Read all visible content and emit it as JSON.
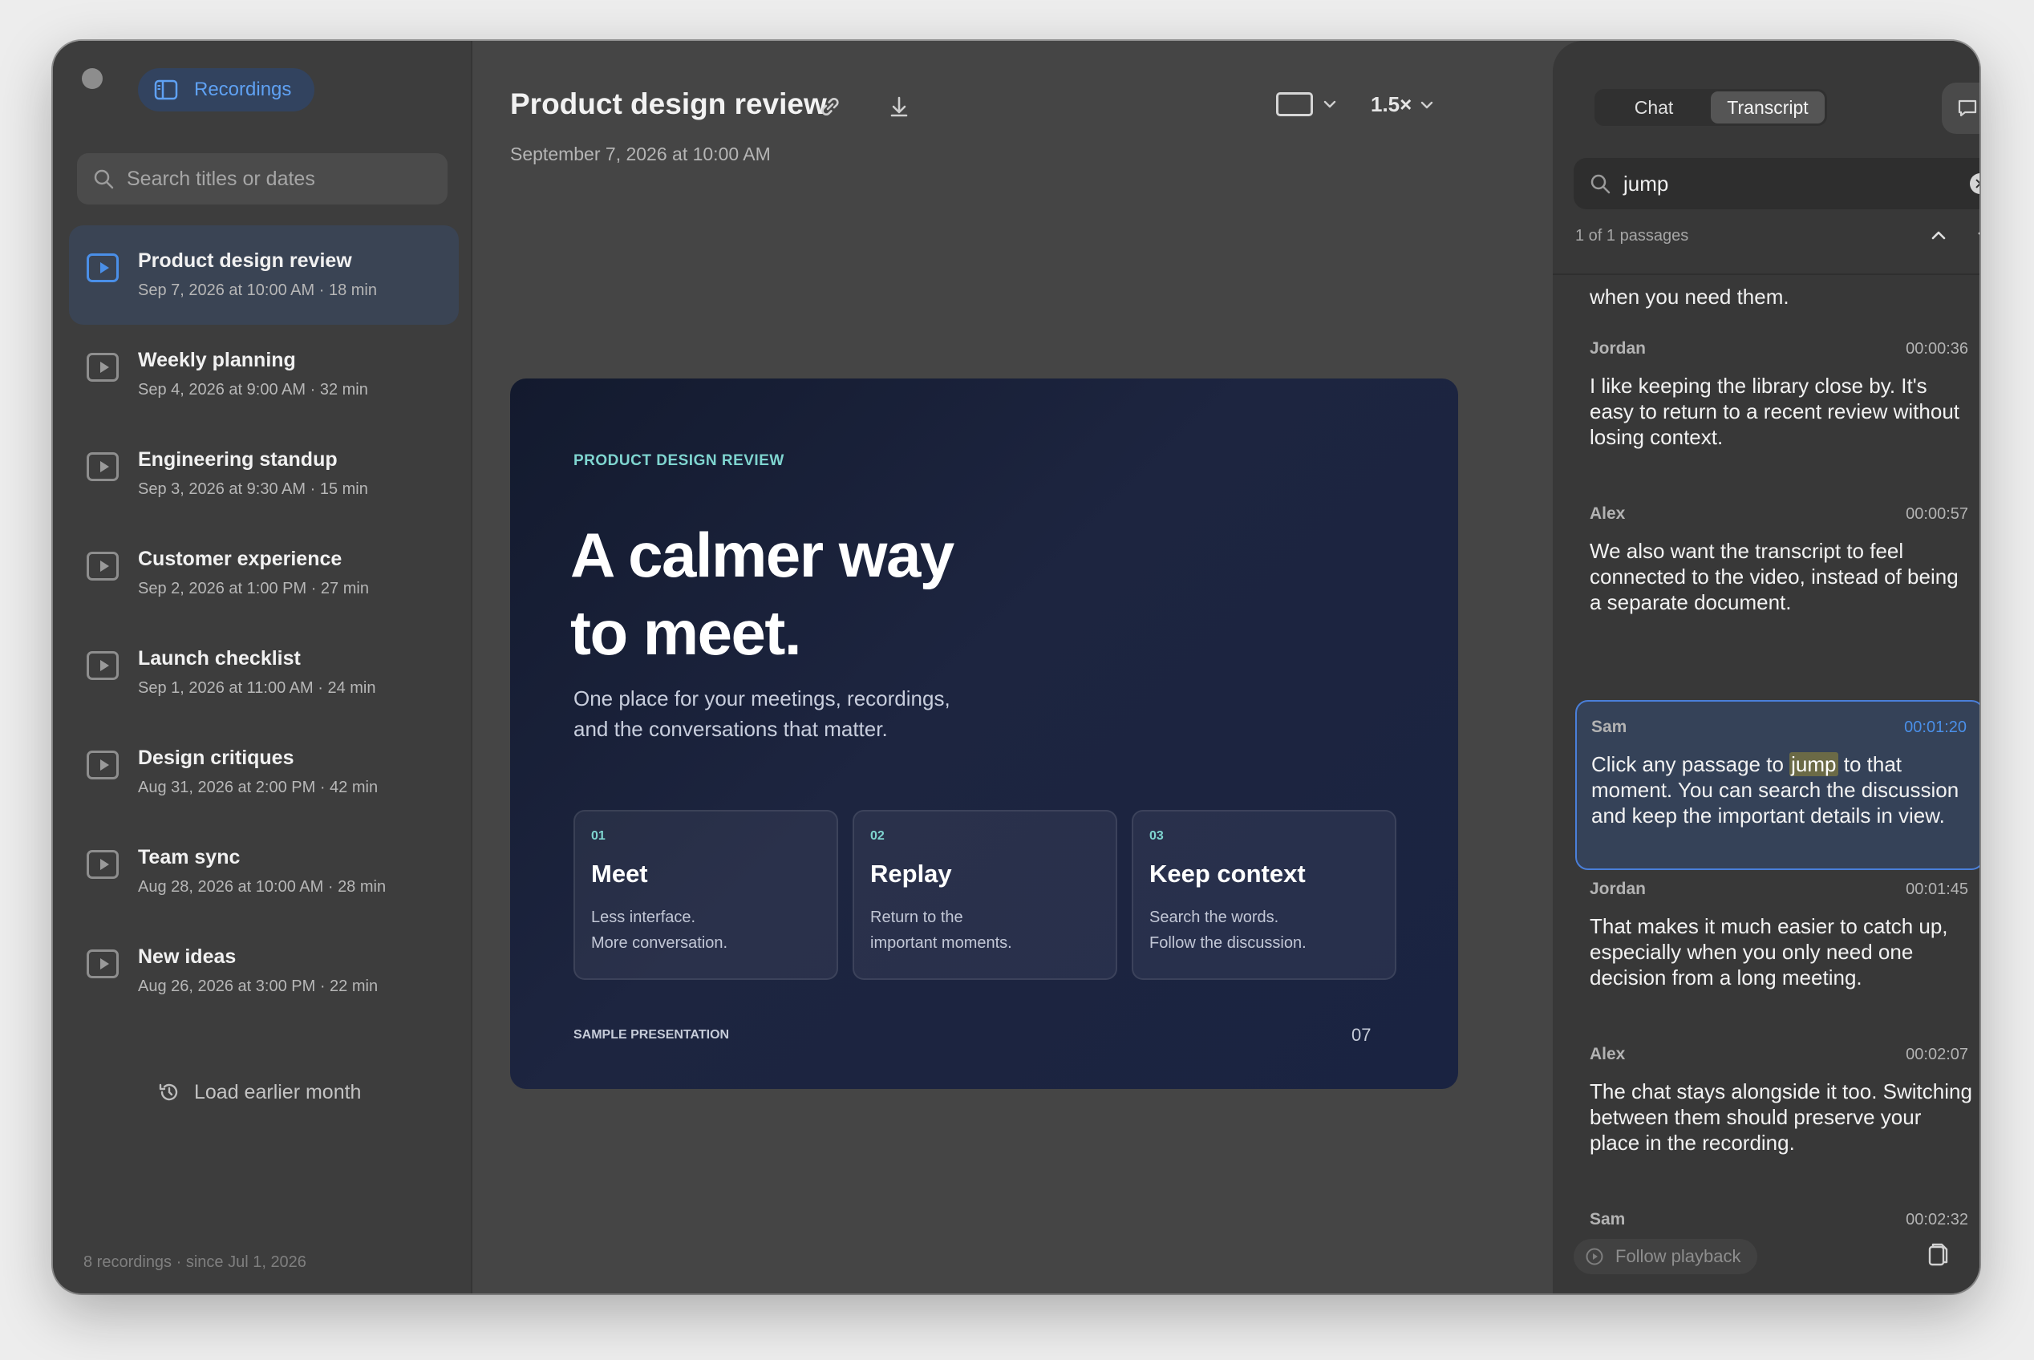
{
  "sidebar": {
    "recordings_label": "Recordings",
    "search_placeholder": "Search titles or dates",
    "items": [
      {
        "title": "Product design review",
        "meta": "Sep 7, 2026 at 10:00 AM · 18 min",
        "active": true
      },
      {
        "title": "Weekly planning",
        "meta": "Sep 4, 2026 at 9:00 AM · 32 min"
      },
      {
        "title": "Engineering standup",
        "meta": "Sep 3, 2026 at 9:30 AM · 15 min"
      },
      {
        "title": "Customer experience",
        "meta": "Sep 2, 2026 at 1:00 PM · 27 min"
      },
      {
        "title": "Launch checklist",
        "meta": "Sep 1, 2026 at 11:00 AM · 24 min"
      },
      {
        "title": "Design critiques",
        "meta": "Aug 31, 2026 at 2:00 PM · 42 min"
      },
      {
        "title": "Team sync",
        "meta": "Aug 28, 2026 at 10:00 AM · 28 min"
      },
      {
        "title": "New ideas",
        "meta": "Aug 26, 2026 at 3:00 PM · 22 min"
      }
    ],
    "load_earlier": "Load earlier month",
    "footer": "8 recordings · since Jul 1, 2026"
  },
  "main": {
    "title": "Product design review",
    "date": "September 7, 2026 at 10:00 AM",
    "speed": "1.5×",
    "slide": {
      "eyebrow": "PRODUCT DESIGN REVIEW",
      "headline_line1": "A calmer way",
      "headline_line2": "to meet.",
      "sub_line1": "One place for your meetings, recordings,",
      "sub_line2": "and the conversations that matter.",
      "cards": [
        {
          "num": "01",
          "title": "Meet",
          "line1": "Less interface.",
          "line2": "More conversation."
        },
        {
          "num": "02",
          "title": "Replay",
          "line1": "Return to the",
          "line2": "important moments."
        },
        {
          "num": "03",
          "title": "Keep context",
          "line1": "Search the words.",
          "line2": "Follow the discussion."
        }
      ],
      "footer": "SAMPLE PRESENTATION",
      "page": "07"
    }
  },
  "panel": {
    "tabs": [
      "Chat",
      "Transcript"
    ],
    "active_tab": "Transcript",
    "search_query": "jump",
    "passages": "1 of 1 passages",
    "top_fragment": "when you need them.",
    "entries": [
      {
        "speaker": "Jordan",
        "time": "00:00:36",
        "text": "I like keeping the library close by. It's easy to return to a recent review without losing context."
      },
      {
        "speaker": "Alex",
        "time": "00:00:57",
        "text": "We also want the transcript to feel connected to the video, instead of being a separate document."
      },
      {
        "speaker": "Sam",
        "time": "00:01:20",
        "text_before": "Click any passage to ",
        "match": "jump",
        "text_after": " to that moment. You can search the discussion and keep the important details in view."
      },
      {
        "speaker": "Jordan",
        "time": "00:01:45",
        "text": "That makes it much easier to catch up, especially when you only need one decision from a long meeting."
      },
      {
        "speaker": "Alex",
        "time": "00:02:07",
        "text": "The chat stays alongside it too. Switching between them should preserve your place in the recording."
      },
      {
        "speaker": "Sam",
        "time": "00:02:32",
        "text": ""
      }
    ],
    "follow_playback": "Follow playback"
  }
}
